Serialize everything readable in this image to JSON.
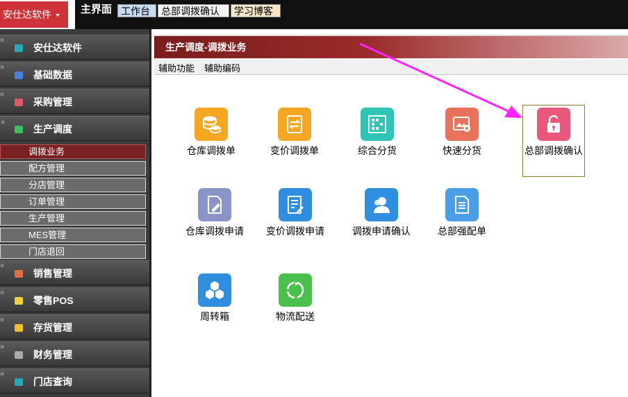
{
  "brand": {
    "label": "安仕达软件"
  },
  "tabs": {
    "main": "主界面",
    "t1": "工作台",
    "t2": "总部调拨确认",
    "t3": "学习博客"
  },
  "sidebar": {
    "menus": [
      {
        "label": "安仕达软件",
        "color": "#2aa6b8"
      },
      {
        "label": "基础数据",
        "color": "#4a80e0"
      },
      {
        "label": "采购管理",
        "color": "#e05a6a"
      },
      {
        "label": "生产调度",
        "color": "#3cc060"
      },
      {
        "label": "销售管理",
        "color": "#e07040"
      },
      {
        "label": "零售POS",
        "color": "#f0d040"
      },
      {
        "label": "存货管理",
        "color": "#f0c030"
      },
      {
        "label": "财务管理",
        "color": "#aaaaaa"
      },
      {
        "label": "门店查询",
        "color": "#2aa6b8"
      }
    ],
    "submenu": [
      "调拨业务",
      "配方管理",
      "分店管理",
      "订单管理",
      "生产管理",
      "MES管理",
      "门店退回"
    ]
  },
  "content": {
    "title": "生产调度-调拨业务",
    "toolbar": [
      "辅助功能",
      "辅助编码"
    ],
    "tiles": [
      {
        "label": "仓库调拨单",
        "color": "#f5a623",
        "icon": "coins-icon"
      },
      {
        "label": "变价调拨单",
        "color": "#f5a623",
        "icon": "exchange-icon"
      },
      {
        "label": "综合分货",
        "color": "#2ec4b6",
        "icon": "grid-icon"
      },
      {
        "label": "快速分货",
        "color": "#e8735a",
        "icon": "gear-photo-icon"
      },
      {
        "label": "总部调拨确认",
        "color": "#e8587a",
        "icon": "unlock-icon"
      },
      {
        "label": "仓库调拨申请",
        "color": "#8a94c8",
        "icon": "doc-edit-icon"
      },
      {
        "label": "变价调拨申请",
        "color": "#2f8ee0",
        "icon": "doc-pen-icon"
      },
      {
        "label": "调拨申请确认",
        "color": "#2f8ee0",
        "icon": "user-icon"
      },
      {
        "label": "总部强配单",
        "color": "#4a9ee6",
        "icon": "list-doc-icon"
      },
      {
        "label": "周转箱",
        "color": "#2f8ee0",
        "icon": "cubes-icon"
      },
      {
        "label": "物流配送",
        "color": "#4cc04c",
        "icon": "recycle-icon"
      }
    ]
  },
  "colors": {
    "accent": "#d0323a",
    "header": "#8a2020",
    "arrow": "#ff22ff"
  }
}
